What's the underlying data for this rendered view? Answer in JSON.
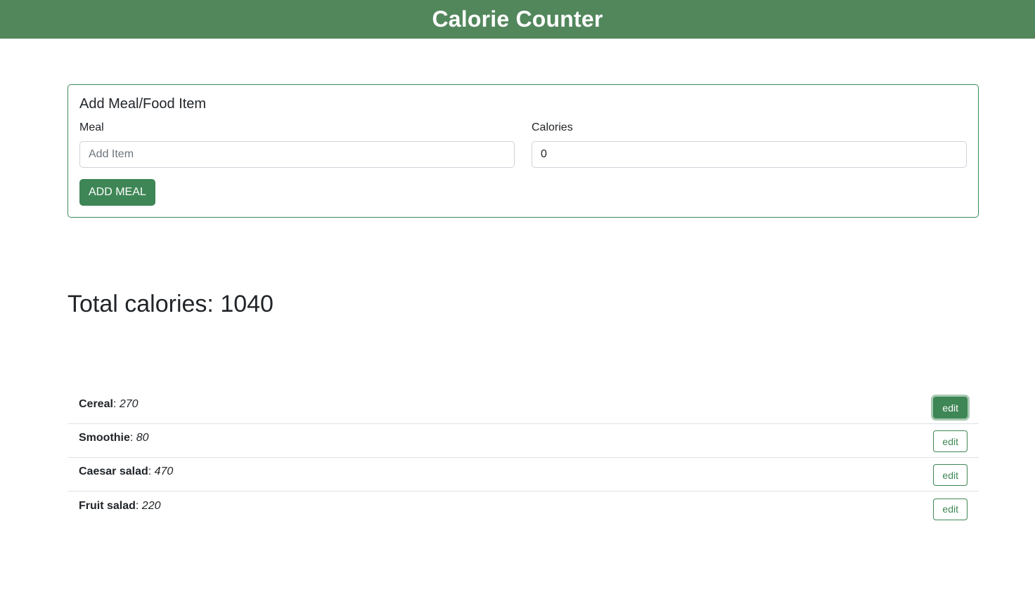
{
  "header": {
    "title": "Calorie Counter"
  },
  "add_card": {
    "title": "Add Meal/Food Item",
    "meal_label": "Meal",
    "meal_placeholder": "Add Item",
    "meal_value": "",
    "calories_label": "Calories",
    "calories_value": "0",
    "add_button_label": "ADD MEAL"
  },
  "total": {
    "label": "Total calories:",
    "value": "1040"
  },
  "meals": [
    {
      "name": "Cereal",
      "calories": "270",
      "edit_label": "edit",
      "active": true
    },
    {
      "name": "Smoothie",
      "calories": "80",
      "edit_label": "edit",
      "active": false
    },
    {
      "name": "Caesar salad",
      "calories": "470",
      "edit_label": "edit",
      "active": false
    },
    {
      "name": "Fruit salad",
      "calories": "220",
      "edit_label": "edit",
      "active": false
    }
  ],
  "colors": {
    "brand_green": "#52875c",
    "button_green": "#3e8655"
  }
}
